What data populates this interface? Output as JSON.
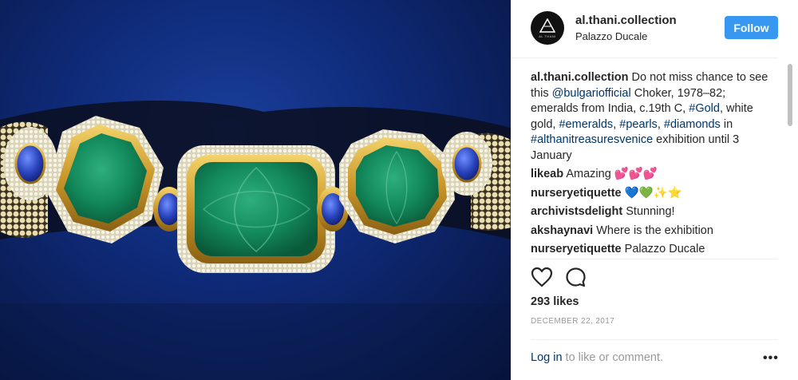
{
  "post": {
    "photo_alt": "",
    "header": {
      "username": "al.thani.collection",
      "location": "Palazzo Ducale",
      "follow_label": "Follow",
      "avatar_icon": "triangle-logo-icon",
      "avatar_text": "AL THANI"
    },
    "caption": {
      "username": "al.thani.collection",
      "parts": [
        {
          "text": "Do not miss chance to see this ",
          "type": "text"
        },
        {
          "text": "@bulgariofficial",
          "type": "mention"
        },
        {
          "text": " Choker, 1978–82; emeralds from India, c.19th C, ",
          "type": "text"
        },
        {
          "text": "#Gold",
          "type": "hashtag"
        },
        {
          "text": ", white gold, ",
          "type": "text"
        },
        {
          "text": "#emeralds",
          "type": "hashtag"
        },
        {
          "text": ", ",
          "type": "text"
        },
        {
          "text": "#pearls",
          "type": "hashtag"
        },
        {
          "text": ", ",
          "type": "text"
        },
        {
          "text": "#diamonds",
          "type": "hashtag"
        },
        {
          "text": " in ",
          "type": "text"
        },
        {
          "text": "#althanitreasuresvenice",
          "type": "hashtag"
        },
        {
          "text": " exhibition until 3 January",
          "type": "text"
        }
      ]
    },
    "comments": [
      {
        "username": "likeab",
        "text": "Amazing 💕💕💕"
      },
      {
        "username": "nurseryetiquette",
        "text": "💙💚✨⭐"
      },
      {
        "username": "archivistsdelight",
        "text": "Stunning!"
      },
      {
        "username": "akshaynavi",
        "text": "Where is the exhibition"
      },
      {
        "username": "nurseryetiquette",
        "text": "Palazzo Ducale"
      }
    ],
    "actions": {
      "like_icon": "heart-icon",
      "comment_icon": "comment-bubble-icon"
    },
    "likes_text": "293 likes",
    "date_text": "DECEMBER 22, 2017",
    "login": {
      "link_text": "Log in",
      "rest_text": " to like or comment.",
      "more_icon": "more-options-icon",
      "more_glyph": "•••"
    },
    "colors": {
      "accent": "#3897f0",
      "link": "#003569",
      "muted": "#999999"
    }
  }
}
